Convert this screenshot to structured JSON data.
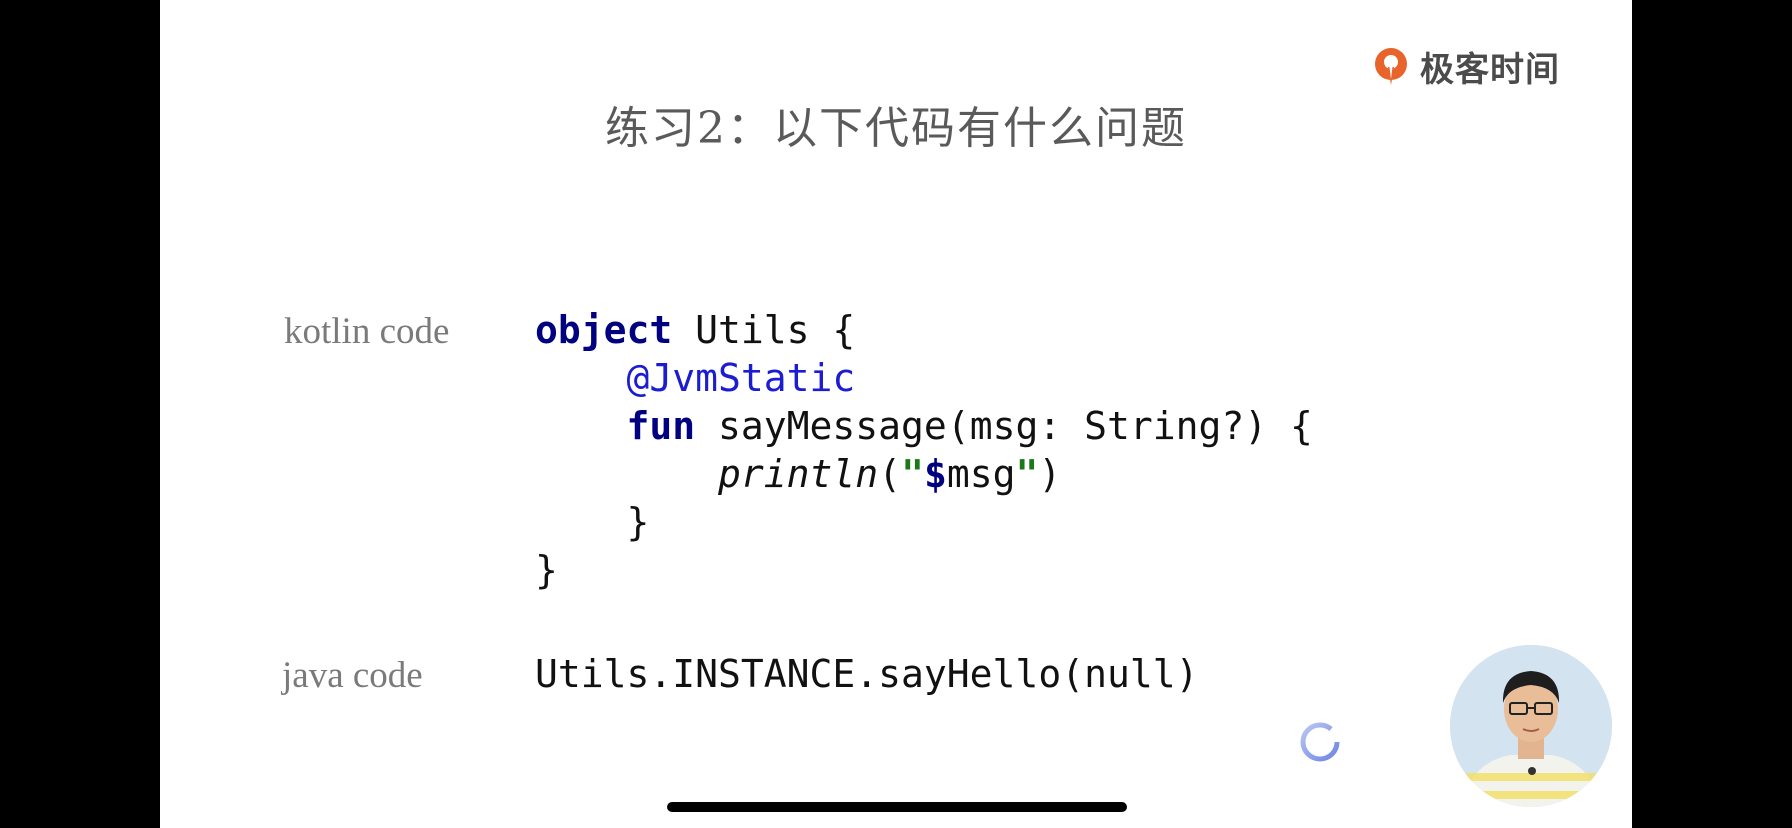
{
  "logo": {
    "text": "极客时间",
    "accent_color": "#e8642b"
  },
  "slide": {
    "title": "练习2：以下代码有什么问题",
    "kotlin_label": "kotlin code",
    "java_label": "java code"
  },
  "kotlin_code": {
    "line1_kw": "object",
    "line1_rest": " Utils {",
    "line2_annotation": "@JvmStatic",
    "line3_kw": "fun",
    "line3_rest": " sayMessage(msg: String?) {",
    "line4_fn": "println",
    "line4_open": "(",
    "line4_quote_open": "\"",
    "line4_dollar": "$",
    "line4_var": "msg",
    "line4_quote_close": "\"",
    "line4_close": ")",
    "line5": "}",
    "line6": "}"
  },
  "java_code": {
    "line1": "Utils.INSTANCE.sayHello(null)"
  },
  "icons": {
    "logo": "geekbang-logo-icon",
    "spinner": "loading-spinner-icon",
    "presenter": "presenter-video"
  }
}
